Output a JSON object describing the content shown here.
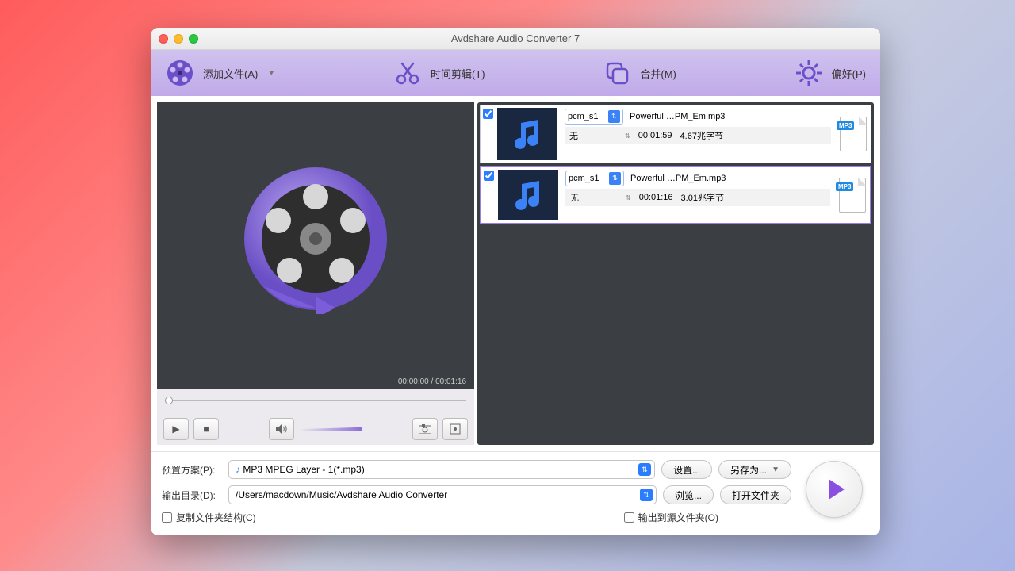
{
  "window": {
    "title": "Avdshare Audio Converter 7"
  },
  "toolbar": {
    "add_file": "添加文件(A)",
    "trim": "时间剪辑(T)",
    "merge": "合并(M)",
    "prefs": "偏好(P)"
  },
  "preview": {
    "time_readout": "00:00:00 / 00:01:16"
  },
  "files": [
    {
      "checked": true,
      "codec": "pcm_s1",
      "name": "Powerful …PM_Em.mp3",
      "effect": "无",
      "duration": "00:01:59",
      "size": "4.67兆字节",
      "badge": "MP3"
    },
    {
      "checked": true,
      "codec": "pcm_s1",
      "name": "Powerful …PM_Em.mp3",
      "effect": "无",
      "duration": "00:01:16",
      "size": "3.01兆字节",
      "badge": "MP3"
    }
  ],
  "bottom": {
    "preset_label": "预置方案(P):",
    "preset_value": "MP3 MPEG Layer - 1(*.mp3)",
    "settings_btn": "设置...",
    "save_as_btn": "另存为...",
    "output_label": "输出目录(D):",
    "output_value": "/Users/macdown/Music/Avdshare Audio Converter",
    "browse_btn": "浏览...",
    "open_folder_btn": "打开文件夹",
    "copy_struct_label": "复制文件夹结构(C)",
    "output_src_label": "输出到源文件夹(O)"
  }
}
